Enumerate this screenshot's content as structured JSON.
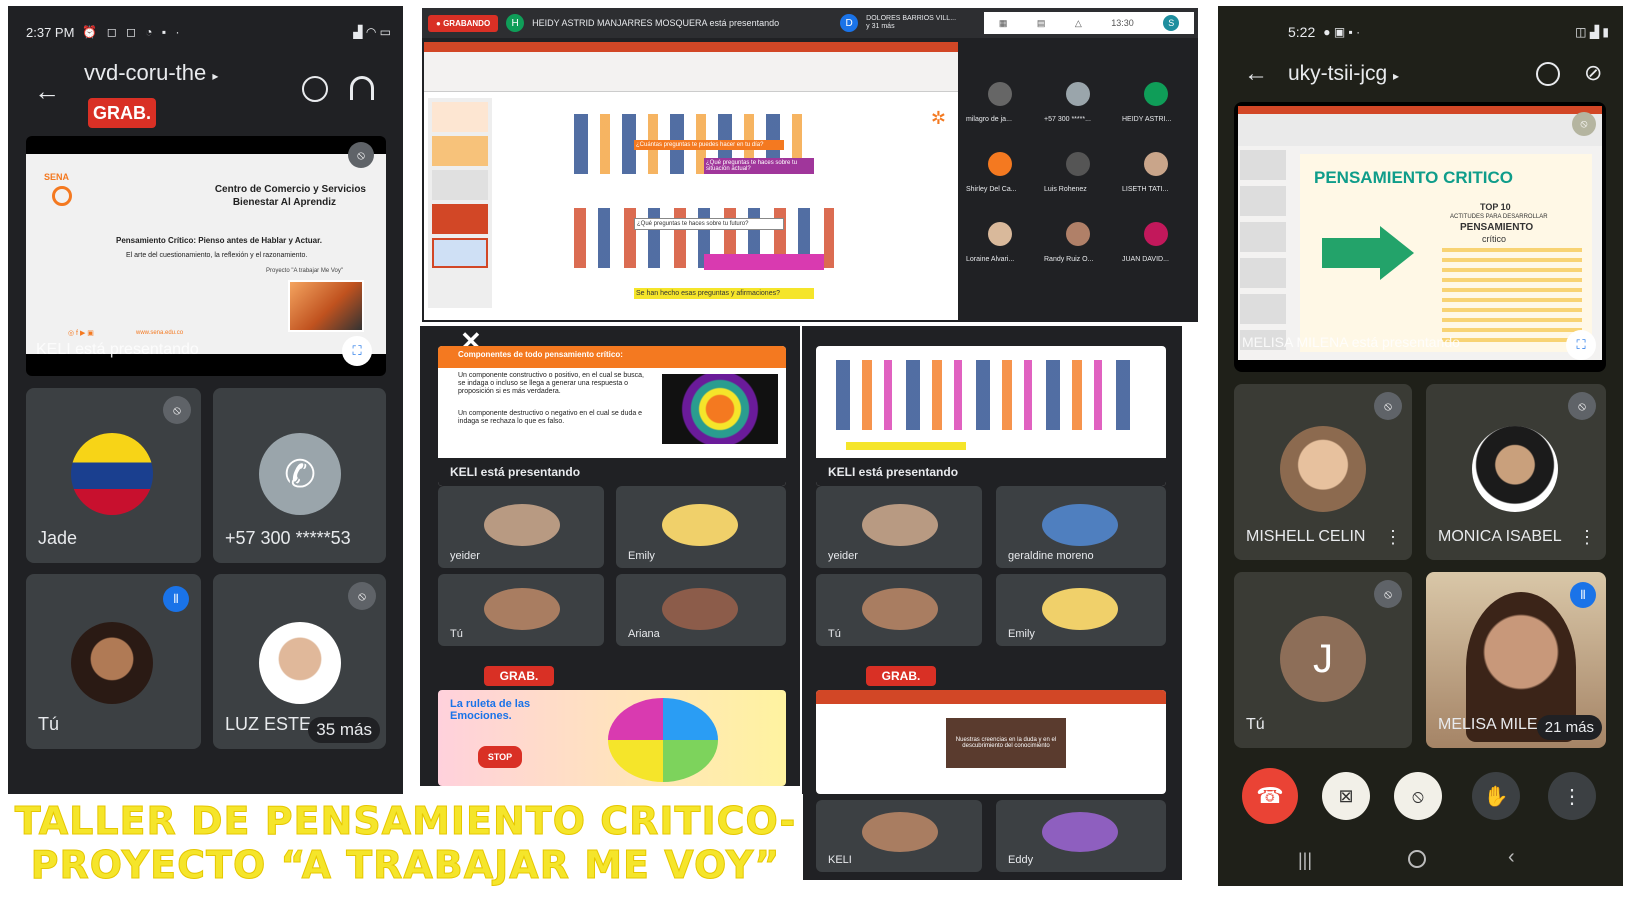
{
  "left": {
    "status_time": "2:37 PM",
    "meet_code": "vvd-coru-the",
    "rec_badge": "GRAB.",
    "slide": {
      "org": "SENA",
      "line1": "Centro de Comercio y Servicios",
      "line2": "Bienestar Al Aprendiz",
      "line3": "Pensamiento Crítico: Pienso antes de Hablar y Actuar.",
      "line4": "El arte del cuestionamiento, la reflexión y el razonamiento.",
      "line5": "Proyecto \"A trabajar Me Voy\"",
      "url": "www.sena.edu.co"
    },
    "presenting": "KELI está presentando",
    "tiles": [
      {
        "name": "Jade"
      },
      {
        "name": "+57 300 *****53"
      },
      {
        "name": "Tú"
      },
      {
        "name": "LUZ ESTE",
        "more": "35 más"
      }
    ]
  },
  "top_mid": {
    "rec": "GRABANDO",
    "presenter_initial": "H",
    "presenter": "HEIDY ASTRID MANJARRES MOSQUERA está presentando",
    "other_initial": "D",
    "other_name": "DOLORES BARRIOS VILL...",
    "other_more": "y 31 más",
    "time": "13:30",
    "user_initial": "S",
    "slide_q1": "¿Cuántas preguntas te puedes hacer en tu día?",
    "slide_q2": "¿Qué preguntas te haces sobre tu situación actual?",
    "slide_q3": "¿Qué preguntas te haces sobre tu futuro?",
    "slide_bottom": "Se han hecho esas preguntas y afirmaciones?",
    "participants": [
      "milagro de ja...",
      "+57 300 *****...",
      "HEIDY ASTRI...",
      "Shirley Del Ca...",
      "Luis Rohenez",
      "LISETH TATI...",
      "Loraine Alvari...",
      "Randy Ruiz O...",
      "JUAN DAVID..."
    ]
  },
  "mid_a": {
    "slide_title": "Componentes de todo pensamiento crítico:",
    "bullet1": "Un componente constructivo o positivo, en el cual se busca, se indaga o incluso se llega a generar una respuesta o proposición si es más verdadera.",
    "bullet2": "Un componente destructivo o negativo en el cual se duda e indaga se rechaza lo que es falso.",
    "presenting": "KELI está presentando",
    "people": [
      "yeider",
      "Emily",
      "Tú",
      "Ariana"
    ]
  },
  "mid_b": {
    "presenting": "KELI está presentando",
    "people": [
      "yeider",
      "geraldine moreno",
      "Tú",
      "Emily"
    ]
  },
  "bottom_a": {
    "rec": "GRAB.",
    "title": "La ruleta de las Emociones.",
    "stop": "STOP",
    "presenting": "KELI está presentando"
  },
  "bottom_b": {
    "rec": "GRAB.",
    "slide_text": "Nuestras creencias en la duda y en el descubrimiento del conocimiento",
    "presenting": "KELI está presentando",
    "people": [
      "KELI",
      "Eddy"
    ]
  },
  "banner": {
    "line1": "TALLER DE PENSAMIENTO CRITICO-",
    "line2": "PROYECTO “A TRABAJAR ME VOY”"
  },
  "right": {
    "status_time": "5:22",
    "meet_code": "uky-tsii-jcg",
    "slide_title": "PENSAMIENTO CRITICO",
    "slide_sub1": "TOP 10",
    "slide_sub2": "ACTITUDES PARA DESARROLLAR",
    "slide_sub3": "PENSAMIENTO",
    "slide_sub4": "crítico",
    "presenting": "MELISA MILENA está presentando",
    "tiles": [
      {
        "name": "MISHELL CELIN"
      },
      {
        "name": "MONICA ISABEL"
      },
      {
        "name": "Tú",
        "initial": "J"
      },
      {
        "name": "MELISA MILE",
        "more": "21 más"
      }
    ]
  },
  "colors": {
    "meet_dark": "#202124",
    "tile": "#3c4043",
    "rec_red": "#d93025",
    "banner_yellow": "#f5e52a",
    "hangup": "#ea4335",
    "sena_orange": "#f47920",
    "accent_blue": "#1a73e8"
  }
}
